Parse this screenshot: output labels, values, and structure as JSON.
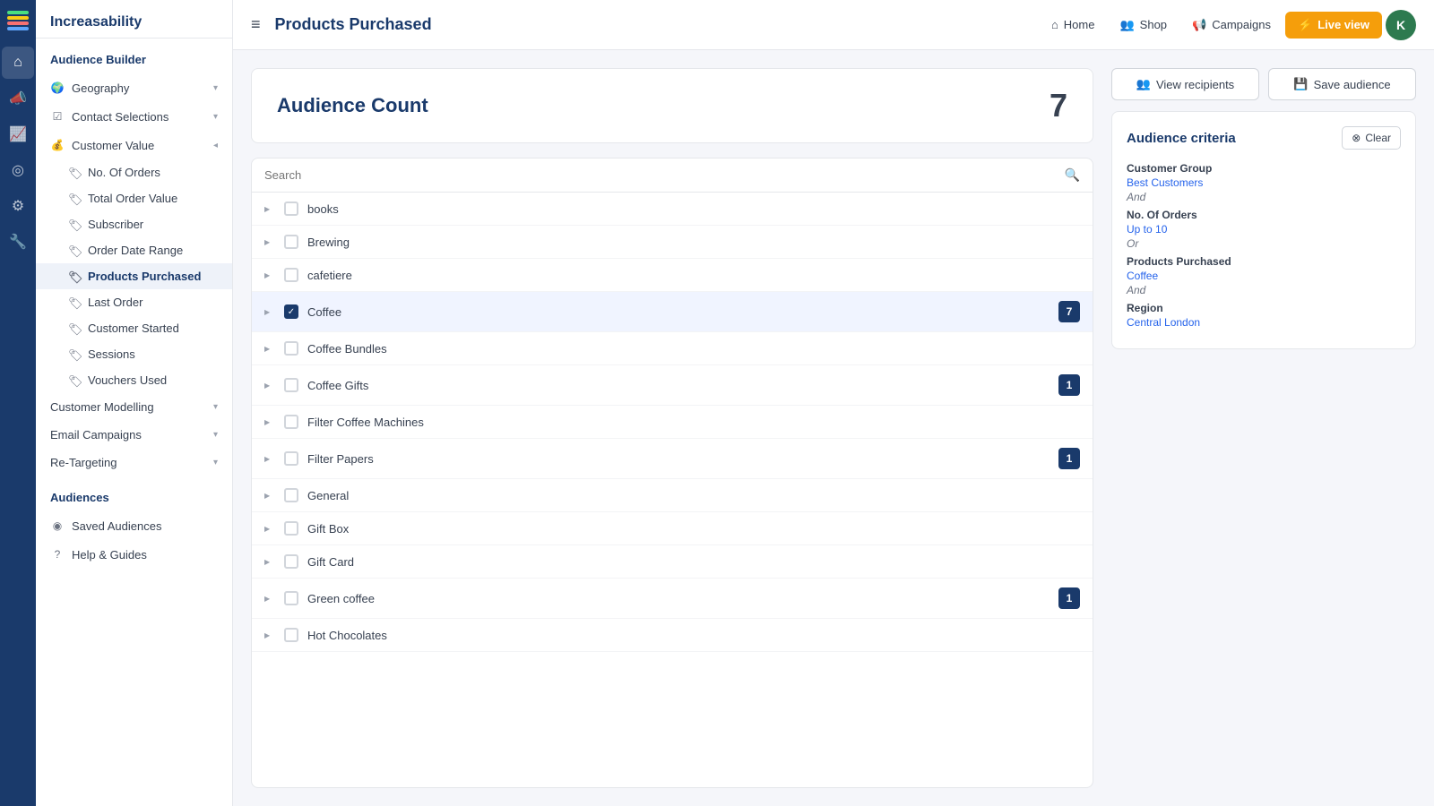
{
  "iconBar": {
    "items": [
      {
        "name": "home-icon",
        "symbol": "⌂"
      },
      {
        "name": "megaphone-icon",
        "symbol": "📣"
      },
      {
        "name": "chart-icon",
        "symbol": "📈"
      },
      {
        "name": "target-icon",
        "symbol": "◎"
      },
      {
        "name": "settings-icon",
        "symbol": "⚙"
      },
      {
        "name": "tools-icon",
        "symbol": "🔧"
      }
    ]
  },
  "sidebar": {
    "appName": "Increasability",
    "builderTitle": "Audience Builder",
    "sections": [
      {
        "name": "Geography",
        "hasChevron": true
      },
      {
        "name": "Contact Selections",
        "hasChevron": true
      },
      {
        "name": "Customer Value",
        "hasChevron": true,
        "expanded": true
      }
    ],
    "subItems": [
      {
        "name": "No. Of Orders",
        "active": false
      },
      {
        "name": "Total Order Value",
        "active": false
      },
      {
        "name": "Subscriber",
        "active": false
      },
      {
        "name": "Order Date Range",
        "active": false
      },
      {
        "name": "Products Purchased",
        "active": true
      },
      {
        "name": "Last Order",
        "active": false
      },
      {
        "name": "Customer Started",
        "active": false
      },
      {
        "name": "Sessions",
        "active": false
      },
      {
        "name": "Vouchers Used",
        "active": false
      }
    ],
    "otherSections": [
      {
        "name": "Customer Modelling",
        "hasChevron": true
      },
      {
        "name": "Email Campaigns",
        "hasChevron": true
      },
      {
        "name": "Re-Targeting",
        "hasChevron": true
      }
    ],
    "audiencesTitle": "Audiences",
    "audienceItems": [
      {
        "name": "Saved Audiences"
      }
    ],
    "bottomItems": [
      {
        "name": "Help & Guides"
      }
    ]
  },
  "topbar": {
    "menuIcon": "≡",
    "title": "Products Purchased",
    "navItems": [
      {
        "label": "Home",
        "icon": "⌂"
      },
      {
        "label": "Shop",
        "icon": "👥"
      },
      {
        "label": "Campaigns",
        "icon": "📢"
      }
    ],
    "liveViewLabel": "Live view",
    "liveViewIcon": "⚡",
    "avatarInitial": "K"
  },
  "audienceCount": {
    "label": "Audience Count",
    "value": "7"
  },
  "searchPlaceholder": "Search",
  "products": [
    {
      "name": "books",
      "checked": false,
      "badge": null
    },
    {
      "name": "Brewing",
      "checked": false,
      "badge": null
    },
    {
      "name": "cafetiere",
      "checked": false,
      "badge": null
    },
    {
      "name": "Coffee",
      "checked": true,
      "badge": "7"
    },
    {
      "name": "Coffee Bundles",
      "checked": false,
      "badge": null
    },
    {
      "name": "Coffee Gifts",
      "checked": false,
      "badge": "1"
    },
    {
      "name": "Filter Coffee Machines",
      "checked": false,
      "badge": null
    },
    {
      "name": "Filter Papers",
      "checked": false,
      "badge": "1"
    },
    {
      "name": "General",
      "checked": false,
      "badge": null
    },
    {
      "name": "Gift Box",
      "checked": false,
      "badge": null
    },
    {
      "name": "Gift Card",
      "checked": false,
      "badge": null
    },
    {
      "name": "Green coffee",
      "checked": false,
      "badge": "1"
    },
    {
      "name": "Hot Chocolates",
      "checked": false,
      "badge": null
    }
  ],
  "rightPanel": {
    "viewRecipientsLabel": "View recipients",
    "saveAudienceLabel": "Save audience",
    "clearLabel": "Clear",
    "criteriaTitle": "Audience criteria",
    "criteria": [
      {
        "key": "Customer Group",
        "value": "Best Customers",
        "connector": "And"
      },
      {
        "key": "No. Of Orders",
        "value": "Up to 10",
        "connector": "Or"
      },
      {
        "key": "Products Purchased",
        "value": "Coffee",
        "connector": "And"
      },
      {
        "key": "Region",
        "value": "Central London",
        "connector": null
      }
    ]
  }
}
